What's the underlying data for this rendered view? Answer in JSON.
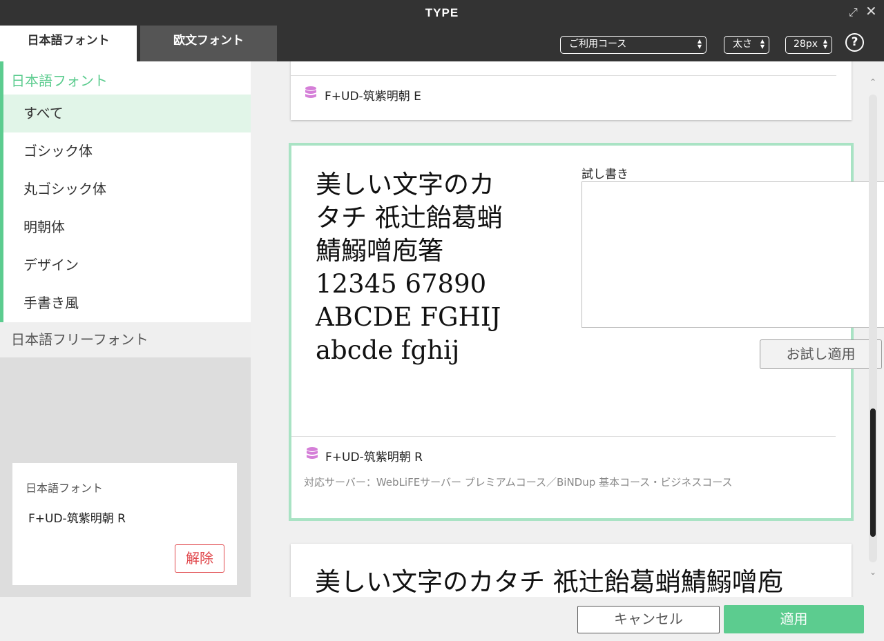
{
  "window": {
    "title": "TYPE",
    "expand_icon": "expand-icon",
    "close_icon": "close-icon"
  },
  "tabs": [
    {
      "label": "日本語フォント",
      "active": true
    },
    {
      "label": "欧文フォント",
      "active": false
    }
  ],
  "toolbar": {
    "course_select": "ご利用コース",
    "weight_select": "太さ",
    "size_select": "28px",
    "help_label": "?"
  },
  "sidebar": {
    "header": "日本語フォント",
    "categories": [
      {
        "label": "すべて",
        "active": true
      },
      {
        "label": "ゴシック体",
        "active": false
      },
      {
        "label": "丸ゴシック体",
        "active": false
      },
      {
        "label": "明朝体",
        "active": false
      },
      {
        "label": "デザイン",
        "active": false
      },
      {
        "label": "手書き風",
        "active": false
      }
    ],
    "free_fonts": "日本語フリーフォント",
    "selected": {
      "label": "日本語フォント",
      "font": "F+UD-筑紫明朝 R",
      "remove_label": "解除"
    }
  },
  "cards": [
    {
      "font_name": "F+UD-筑紫明朝 E"
    },
    {
      "font_name": "F+UD-筑紫明朝 R",
      "preview_lines": [
        "美しい文字のカ",
        "タチ 祇辻飴葛蛸",
        "鯖鰯噌庖箸",
        "12345 67890",
        "ABCDE FGHIJ",
        "abcde fghij"
      ],
      "trial_label": "試し書き",
      "trial_value": "",
      "apply_trial_label": "お試し適用",
      "server_info": "対応サーバー：WebLiFEサーバー プレミアムコース／BiNDup 基本コース・ビジネスコース"
    },
    {
      "preview_text": "美しい文字のカタチ 祇辻飴葛蛸鯖鰯噌庖"
    }
  ],
  "footer": {
    "cancel_label": "キャンセル",
    "apply_label": "適用"
  },
  "colors": {
    "accent": "#5ccc8f",
    "titlebar": "#333333",
    "danger": "#e0464a",
    "db_icon": "#d57fd8"
  }
}
